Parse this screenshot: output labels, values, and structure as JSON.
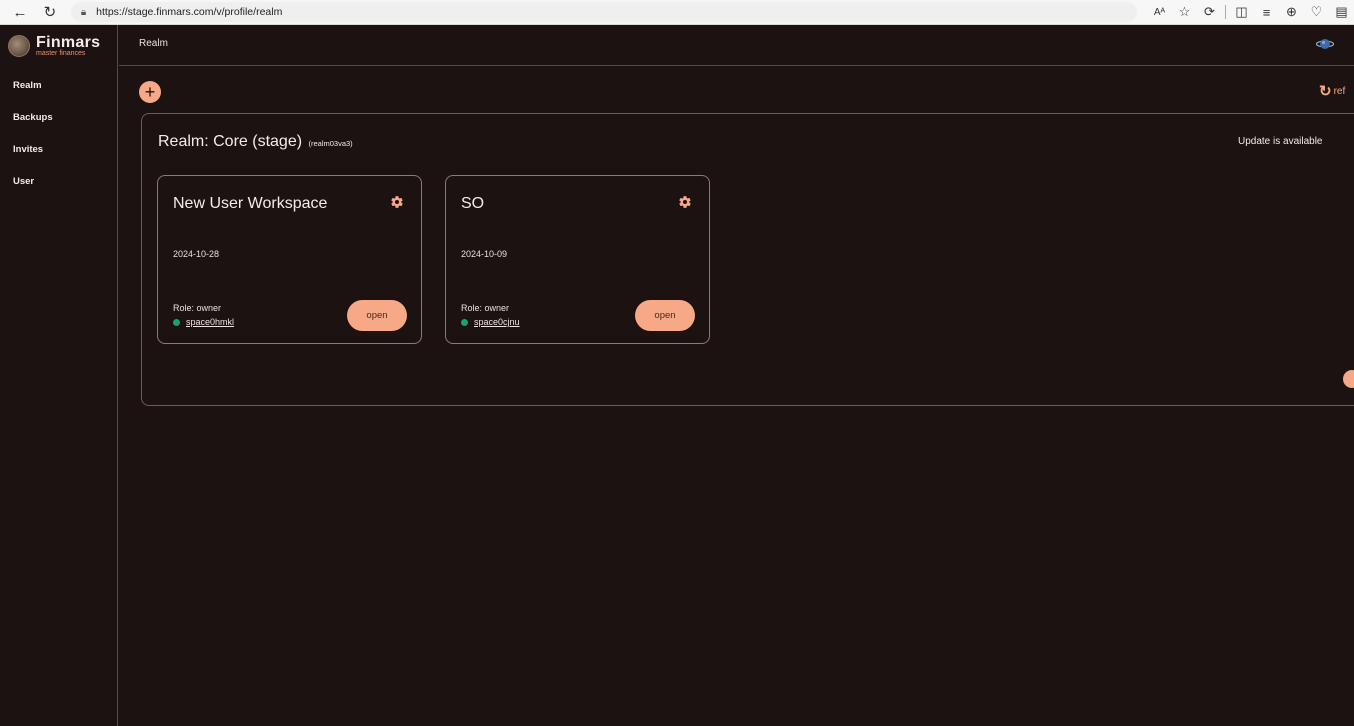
{
  "browser": {
    "url_host": "https://stage.finmars.com",
    "url_path": "/v/profile/realm",
    "read_aloud_glyph": "Aᴬ"
  },
  "brand": {
    "name": "Finmars",
    "tagline": "master finances"
  },
  "sidebar": {
    "items": [
      {
        "label": "Realm"
      },
      {
        "label": "Backups"
      },
      {
        "label": "Invites"
      },
      {
        "label": "User"
      }
    ]
  },
  "topbar": {
    "title": "Realm"
  },
  "actions": {
    "refresh_label": "ref"
  },
  "realm": {
    "title": "Realm: Core (stage)",
    "id": "(realm03va3)",
    "update_note": "Update is available",
    "spaces": [
      {
        "name": "New User Workspace",
        "date": "2024-10-28",
        "role": "Role: owner",
        "space_code": "space0hmkl",
        "open_label": "open",
        "status_color": "#19a36a"
      },
      {
        "name": "SO",
        "date": "2024-10-09",
        "role": "Role: owner",
        "space_code": "space0cjnu",
        "open_label": "open",
        "status_color": "#19a36a"
      }
    ]
  },
  "colors": {
    "accent": "#f6a887",
    "background": "#1c1211",
    "border": "#6b5b58",
    "status_online": "#19a36a"
  }
}
